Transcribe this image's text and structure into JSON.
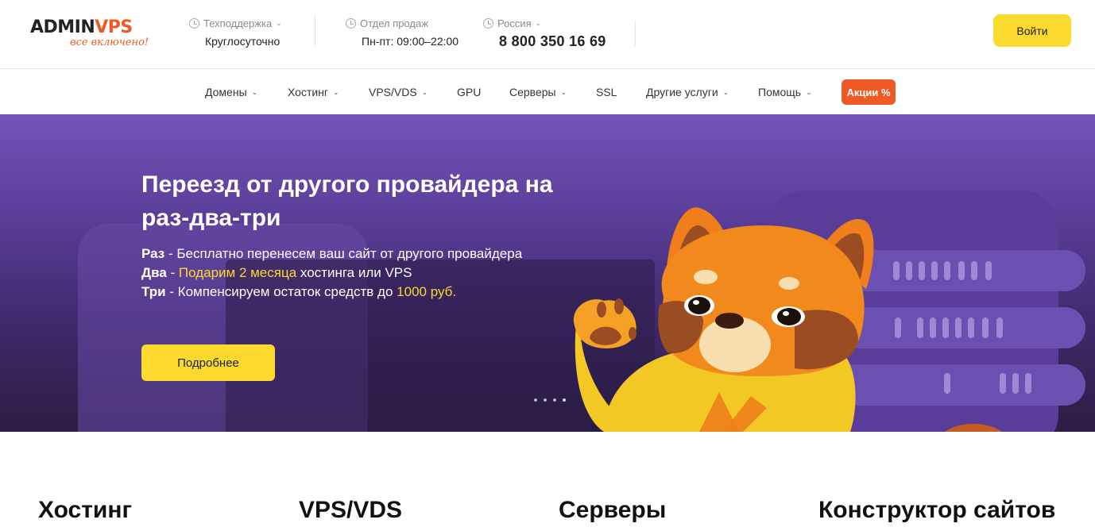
{
  "brand": {
    "logo_main_a": "ADMIN",
    "logo_main_b": "VPS",
    "logo_tagline": "все включено!",
    "accent": "#ef5a24",
    "yellow": "#fbd92e"
  },
  "header": {
    "support": {
      "label": "Техподдержка",
      "value": "Круглосуточно",
      "icon": "clock-icon"
    },
    "sales": {
      "label": "Отдел продаж",
      "value": "Пн-пт: 09:00–22:00",
      "icon": "clock-icon"
    },
    "region": {
      "label": "Россия",
      "value": "8 800 350 16 69",
      "icon": "clock-icon"
    },
    "login_label": "Войти"
  },
  "nav": {
    "items": [
      {
        "label": "Домены",
        "dropdown": true
      },
      {
        "label": "Хостинг",
        "dropdown": true
      },
      {
        "label": "VPS/VDS",
        "dropdown": true
      },
      {
        "label": "GPU",
        "dropdown": false
      },
      {
        "label": "Серверы",
        "dropdown": true
      },
      {
        "label": "SSL",
        "dropdown": false
      },
      {
        "label": "Другие услуги",
        "dropdown": true
      },
      {
        "label": "Помощь",
        "dropdown": true
      }
    ],
    "promo_label": "Акции %"
  },
  "hero": {
    "title": "Переезд от другого провайдера на раз-два-три",
    "line1_key": "Раз",
    "line1_text": " - Бесплатно перенесем ваш сайт от другого провайдера",
    "line2_key": "Два",
    "line2_sep": " - ",
    "line2_highlight": "Подарим 2 месяца",
    "line2_text": " хостинга или VPS",
    "line3_key": "Три",
    "line3_text": " - Компенсируем остаток средств до ",
    "line3_highlight": "1000 руб.",
    "button_label": "Подробнее",
    "slides_total": 4,
    "slide_active": 4
  },
  "categories": [
    "Хостинг",
    "VPS/VDS",
    "Серверы",
    "Конструктор сайтов"
  ]
}
